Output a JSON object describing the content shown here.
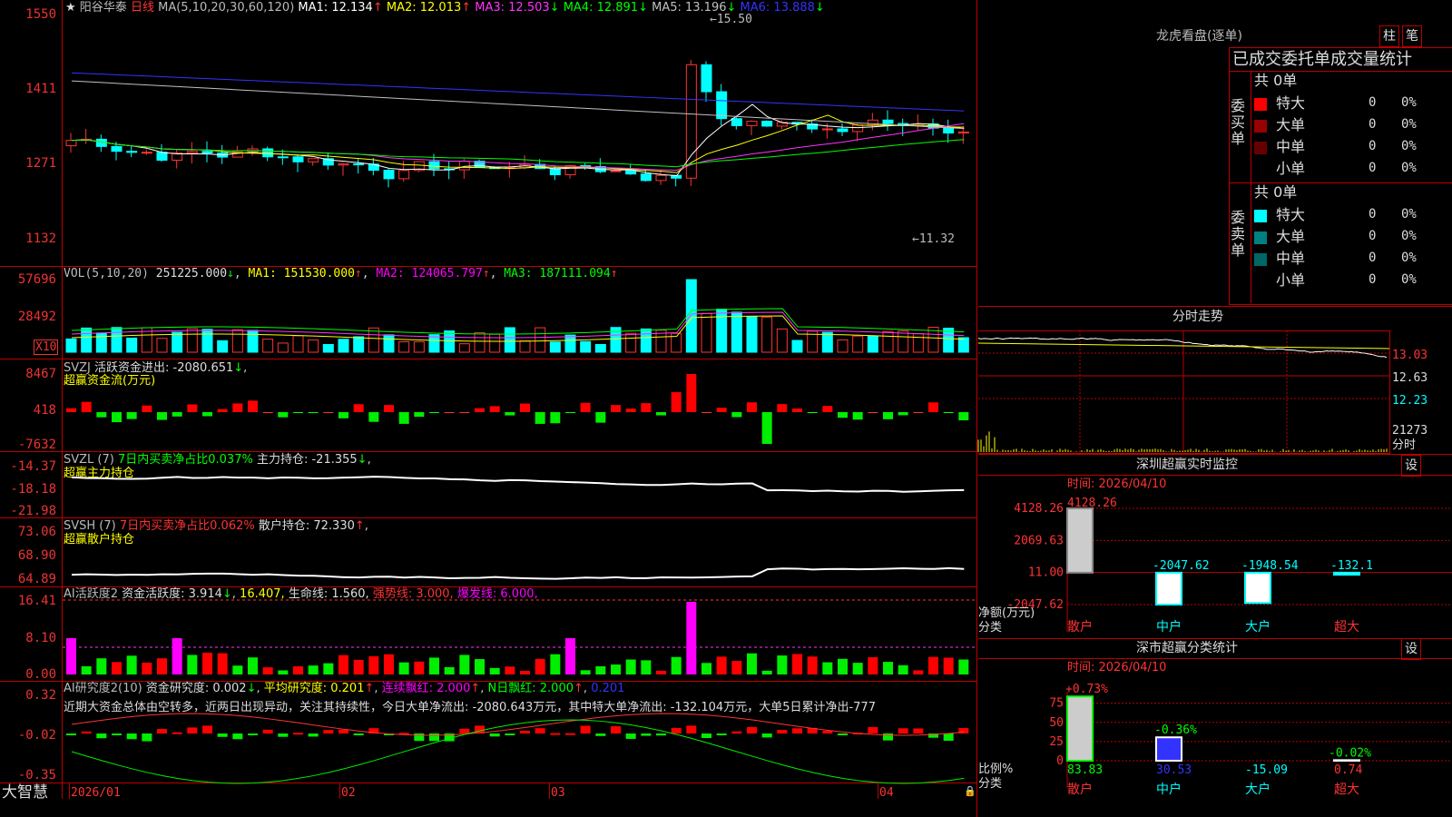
{
  "header": {
    "name": "阳谷华泰",
    "period": "日线",
    "ma_title": "MA(5,10,20,30,60,120)",
    "ma_values": [
      {
        "label": "MA1:",
        "value": "12.134",
        "arrow": "↑",
        "color": "#ffffff"
      },
      {
        "label": "MA2:",
        "value": "12.013",
        "arrow": "↑",
        "color": "#ffff00"
      },
      {
        "label": "MA3:",
        "value": "12.503",
        "arrow": "↓",
        "color": "#ff33ff"
      },
      {
        "label": "MA4:",
        "value": "12.891",
        "arrow": "↓",
        "color": "#00ff00"
      },
      {
        "label": "MA5:",
        "value": "13.196",
        "arrow": "↓",
        "color": "#c0c0c0"
      },
      {
        "label": "MA6:",
        "value": "13.888",
        "arrow": "↓",
        "color": "#3333ff"
      }
    ],
    "high_mark": "15.50",
    "low_mark": "11.32"
  },
  "price_axis": [
    "1550",
    "1411",
    "1271",
    "1132"
  ],
  "vol": {
    "title": "VOL(5,10,20)",
    "value": "251225.000",
    "ma1": "MA1: 151530.000",
    "ma2": "MA2: 124065.797",
    "ma3": "MA3: 187111.094",
    "axis": [
      "57696",
      "28492"
    ],
    "unit": "X10"
  },
  "svzj": {
    "title": "SVZJ",
    "label": "活跃资金进出: -2080.651",
    "subtitle": "超赢资金流(万元)",
    "axis": [
      "8467",
      "418",
      "-7632"
    ]
  },
  "svzl": {
    "title": "SVZL (7)",
    "label1": "7日内买卖净占比0.037%",
    "label2": "主力持仓: -21.355",
    "subtitle": "超赢主力持仓",
    "axis": [
      "-14.37",
      "-18.18",
      "-21.98"
    ]
  },
  "svsh": {
    "title": "SVSH (7)",
    "label1": "7日内买卖净占比0.062%",
    "label2": "散户持仓: 72.330",
    "subtitle": "超赢散户持仓",
    "axis": [
      "73.06",
      "68.90",
      "64.89"
    ]
  },
  "ai1": {
    "title": "AI活跃度2",
    "l1": "资金活跃度: 3.914",
    "l2": "16.407,",
    "l3": "生命线: 1.560,",
    "l4": "强势线: 3.000,",
    "l5": "爆发线: 6.000,",
    "axis": [
      "16.41",
      "8.10",
      "0.00"
    ]
  },
  "ai2": {
    "title": "AI研究度2(10)",
    "l1": "资金研究度: 0.002",
    "l2": "平均研究度: 0.201",
    "l3": "连续飘红: 2.000",
    "l4": "N日飘红: 2.000",
    "l5": "0.201",
    "comment": "近期大资金总体由空转多，近两日出现异动，关注其持续性，今日大单净流出: -2080.643万元，其中特大单净流出: -132.104万元，大单5日累计净出-777",
    "axis": [
      "0.32",
      "-0.02",
      "-0.35"
    ]
  },
  "footer": {
    "brand": "大智慧",
    "dates": [
      "2026/01",
      "02",
      "03",
      "04"
    ]
  },
  "right": {
    "dragon_title": "龙虎看盘(逐单)",
    "btn1": "柱",
    "btn2": "笔",
    "tabs": "已成交委托单成交量统计",
    "buy": {
      "side": "委买单",
      "total": "共 0单",
      "rows": [
        {
          "name": "特大",
          "count": "0",
          "pct": "0%",
          "color": "#ff0000"
        },
        {
          "name": "大单",
          "count": "0",
          "pct": "0%",
          "color": "#990000"
        },
        {
          "name": "中单",
          "count": "0",
          "pct": "0%",
          "color": "#660000"
        },
        {
          "name": "小单",
          "count": "0",
          "pct": "0%",
          "color": "#000000"
        }
      ]
    },
    "sell": {
      "side": "委卖单",
      "total": "共 0单",
      "rows": [
        {
          "name": "特大",
          "count": "0",
          "pct": "0%",
          "color": "#00ffff"
        },
        {
          "name": "大单",
          "count": "0",
          "pct": "0%",
          "color": "#008080"
        },
        {
          "name": "中单",
          "count": "0",
          "pct": "0%",
          "color": "#006666"
        },
        {
          "name": "小单",
          "count": "0",
          "pct": "0%",
          "color": "#000000"
        }
      ]
    },
    "minute_title": "分时走势",
    "minute_axis": [
      "13.03",
      "12.63",
      "12.23"
    ],
    "minute_vol": "21273",
    "minute_sub": "分时",
    "sz_monitor": {
      "title": "深圳超赢实时监控",
      "btn": "设",
      "time": "时间: 2026/04/10",
      "axis": [
        "4128.26",
        "2069.63",
        "11.00",
        "-2047.62"
      ],
      "ylabel": "净额(万元)",
      "xlabel": "分类",
      "bars": [
        {
          "cat": "散户",
          "value": 4128.26,
          "label": "4128.26"
        },
        {
          "cat": "中户",
          "value": -2047.62,
          "label": "-2047.62"
        },
        {
          "cat": "大户",
          "value": -1948.54,
          "label": "-1948.54"
        },
        {
          "cat": "超大",
          "value": -132.1,
          "label": "-132.1"
        }
      ]
    },
    "sz_class": {
      "title": "深市超赢分类统计",
      "btn": "设",
      "time": "时间: 2026/04/10",
      "axis": [
        "75",
        "50",
        "25",
        "0"
      ],
      "ylabel": "比例%",
      "xlabel": "分类",
      "bars": [
        {
          "cat": "散户",
          "value": 83.83,
          "label": "83.83",
          "top": "+0.73%"
        },
        {
          "cat": "中户",
          "value": 30.53,
          "label": "30.53",
          "top": "-0.36%"
        },
        {
          "cat": "大户",
          "value": -15.09,
          "label": "-15.09",
          "top": ""
        },
        {
          "cat": "超大",
          "value": 0.74,
          "label": "0.74",
          "top": "-0.02%"
        }
      ]
    }
  },
  "chart_data": {
    "type": "bar",
    "title": "深圳超赢实时监控",
    "categories": [
      "散户",
      "中户",
      "大户",
      "超大"
    ],
    "series": [
      {
        "name": "净额(万元)",
        "values": [
          4128.26,
          -2047.62,
          -1948.54,
          -132.1
        ]
      }
    ]
  }
}
